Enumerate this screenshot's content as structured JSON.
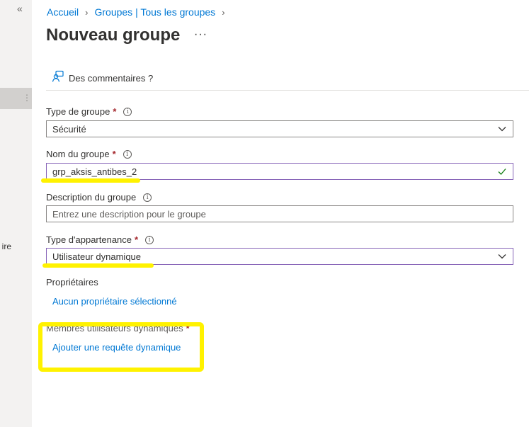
{
  "sidebar": {
    "collapse_glyph": "«",
    "grip_glyph": "⋮",
    "cut_label": "ire"
  },
  "breadcrumb": {
    "items": [
      "Accueil",
      "Groupes | Tous les groupes"
    ]
  },
  "page": {
    "title": "Nouveau groupe",
    "more_label": "···"
  },
  "feedback": {
    "label": "Des commentaires ?",
    "icon": "feedback-person-icon"
  },
  "form": {
    "group_type": {
      "label": "Type de groupe",
      "required": "*",
      "value": "Sécurité"
    },
    "group_name": {
      "label": "Nom du groupe",
      "required": "*",
      "value": "grp_aksis_antibes_2"
    },
    "description": {
      "label": "Description du groupe",
      "placeholder": "Entrez une description pour le groupe"
    },
    "membership_type": {
      "label": "Type d'appartenance",
      "required": "*",
      "value": "Utilisateur dynamique"
    },
    "owners": {
      "label": "Propriétaires",
      "link": "Aucun propriétaire sélectionné"
    },
    "dynamic_members": {
      "label": "Membres utilisateurs dynamiques",
      "required": "*",
      "link": "Ajouter une requête dynamique"
    }
  },
  "colors": {
    "accent": "#0078d4",
    "required": "#a4262c",
    "annotation": "#fff200",
    "active_border": "#8764b8",
    "valid": "#107c10"
  }
}
